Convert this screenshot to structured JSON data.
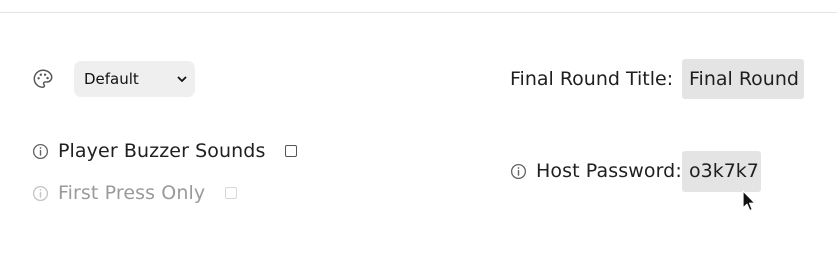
{
  "theme": {
    "icon": "palette-icon",
    "selected": "Default"
  },
  "settings": {
    "buzzer_sounds_label": "Player Buzzer Sounds",
    "buzzer_sounds_checked": false,
    "first_press_label": "First Press Only",
    "first_press_checked": false,
    "first_press_disabled": true
  },
  "final_round": {
    "label": "Final Round Title:",
    "value": "Final Round"
  },
  "host_password": {
    "label": "Host Password:",
    "value": "o3k7k7"
  },
  "colors": {
    "input_bg": "#e4e4e4",
    "select_bg": "#efefef",
    "disabled_text": "#9a9a9a"
  }
}
